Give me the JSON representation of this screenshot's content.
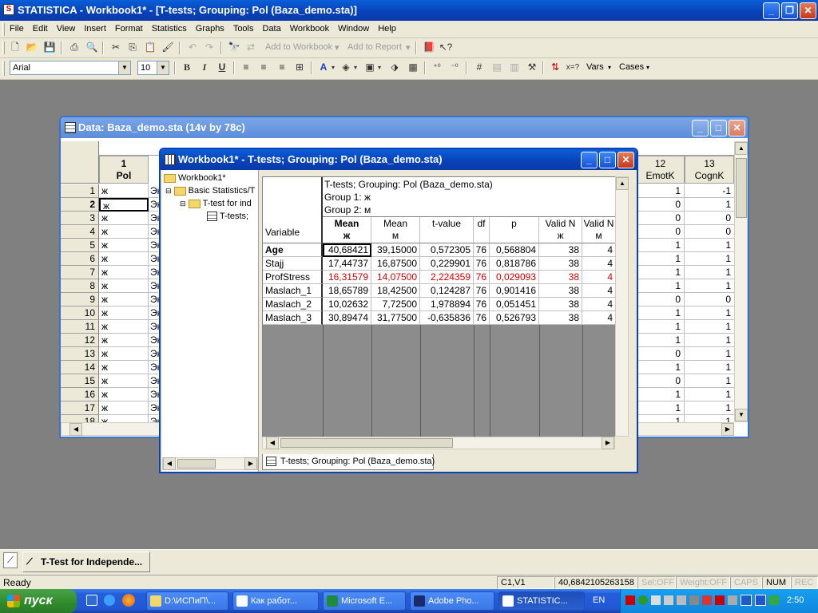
{
  "app": {
    "title": "STATISTICA - Workbook1* - [T-tests; Grouping: Pol (Baza_demo.sta)]",
    "icon_letter": "S"
  },
  "menu": [
    "File",
    "Edit",
    "View",
    "Insert",
    "Format",
    "Statistics",
    "Graphs",
    "Tools",
    "Data",
    "Workbook",
    "Window",
    "Help"
  ],
  "toolbar": {
    "add_to_workbook": "Add to Workbook",
    "add_to_report": "Add to Report",
    "font": "Arial",
    "font_size": "10",
    "bold": "B",
    "italic": "I",
    "underline": "U",
    "vars": "Vars",
    "cases": "Cases"
  },
  "datawin": {
    "title": "Data: Baza_demo.sta (14v by 78c)",
    "col1_num": "1",
    "col1_name": "Pol",
    "col12_num": "12",
    "col12_name": "EmotK",
    "col13_num": "13",
    "col13_name": "CognK",
    "rows": [
      {
        "n": "1",
        "pol": "ж",
        "e": "Эк",
        "c12": "1",
        "c13": "-1"
      },
      {
        "n": "2",
        "pol": "ж",
        "e": "Эк",
        "c12": "0",
        "c13": "1"
      },
      {
        "n": "3",
        "pol": "ж",
        "e": "Эк",
        "c12": "0",
        "c13": "0"
      },
      {
        "n": "4",
        "pol": "ж",
        "e": "Эк",
        "c12": "0",
        "c13": "0"
      },
      {
        "n": "5",
        "pol": "ж",
        "e": "Эк",
        "c12": "1",
        "c13": "1"
      },
      {
        "n": "6",
        "pol": "ж",
        "e": "Эк",
        "c12": "1",
        "c13": "1"
      },
      {
        "n": "7",
        "pol": "ж",
        "e": "Эк",
        "c12": "1",
        "c13": "1"
      },
      {
        "n": "8",
        "pol": "ж",
        "e": "Эк",
        "c12": "1",
        "c13": "1"
      },
      {
        "n": "9",
        "pol": "ж",
        "e": "Эк",
        "c12": "0",
        "c13": "0"
      },
      {
        "n": "10",
        "pol": "ж",
        "e": "Эк",
        "c12": "1",
        "c13": "1"
      },
      {
        "n": "11",
        "pol": "ж",
        "e": "Эк",
        "c12": "1",
        "c13": "1"
      },
      {
        "n": "12",
        "pol": "ж",
        "e": "Эк",
        "c12": "1",
        "c13": "1"
      },
      {
        "n": "13",
        "pol": "ж",
        "e": "Эк",
        "c12": "0",
        "c13": "1"
      },
      {
        "n": "14",
        "pol": "ж",
        "e": "Эк",
        "c12": "1",
        "c13": "1"
      },
      {
        "n": "15",
        "pol": "ж",
        "e": "Эк",
        "c12": "0",
        "c13": "1"
      },
      {
        "n": "16",
        "pol": "ж",
        "e": "Эк",
        "c12": "1",
        "c13": "1"
      },
      {
        "n": "17",
        "pol": "ж",
        "e": "Эк",
        "c12": "1",
        "c13": "1"
      },
      {
        "n": "18",
        "pol": "ж",
        "e": "Эк",
        "c12": "1",
        "c13": "1"
      }
    ]
  },
  "wbwin": {
    "title": "Workbook1* - T-tests; Grouping: Pol (Baza_demo.sta)",
    "tree": [
      "Workbook1*",
      "Basic Statistics/T",
      "T-test for ind",
      "T-tests;"
    ],
    "tab": "T-tests; Grouping: Pol (Baza_demo.sta)",
    "header_lines": [
      "T-tests; Grouping: Pol (Baza_demo.sta)",
      "Group 1: ж",
      "Group 2: м"
    ],
    "variable_label": "Variable",
    "cols": [
      {
        "a": "Mean",
        "b": "ж"
      },
      {
        "a": "Mean",
        "b": "м"
      },
      {
        "a": "t-value",
        "b": ""
      },
      {
        "a": "df",
        "b": ""
      },
      {
        "a": "p",
        "b": ""
      },
      {
        "a": "Valid N",
        "b": "ж"
      },
      {
        "a": "Valid N",
        "b": "м"
      }
    ],
    "rows": [
      {
        "v": "Age",
        "m1": "40,68421",
        "m2": "39,15000",
        "t": "0,572305",
        "df": "76",
        "p": "0,568804",
        "n1": "38",
        "n2": "4"
      },
      {
        "v": "Stajj",
        "m1": "17,44737",
        "m2": "16,87500",
        "t": "0,229901",
        "df": "76",
        "p": "0,818786",
        "n1": "38",
        "n2": "4"
      },
      {
        "v": "ProfStress",
        "m1": "16,31579",
        "m2": "14,07500",
        "t": "2,224359",
        "df": "76",
        "p": "0,029093",
        "n1": "38",
        "n2": "4"
      },
      {
        "v": "Maslach_1",
        "m1": "18,65789",
        "m2": "18,42500",
        "t": "0,124287",
        "df": "76",
        "p": "0,901416",
        "n1": "38",
        "n2": "4"
      },
      {
        "v": "Maslach_2",
        "m1": "10,02632",
        "m2": "7,72500",
        "t": "1,978894",
        "df": "76",
        "p": "0,051451",
        "n1": "38",
        "n2": "4"
      },
      {
        "v": "Maslach_3",
        "m1": "30,89474",
        "m2": "31,77500",
        "t": "-0,635836",
        "df": "76",
        "p": "0,526793",
        "n1": "38",
        "n2": "4"
      }
    ],
    "highlight_color": "#d40000"
  },
  "minimized": {
    "label": "T-Test for Independe..."
  },
  "status": {
    "ready": "Ready",
    "cell": "C1,V1",
    "value": "40,6842105263158",
    "sel": "Sel:OFF",
    "weight": "Weight:OFF",
    "caps": "CAPS",
    "num": "NUM",
    "rec": "REC"
  },
  "taskbar": {
    "start": "пуск",
    "tasks": [
      "D:\\ИСПиП\\...",
      "Как работ...",
      "Microsoft E...",
      "Adobe Pho...",
      "STATISTIC..."
    ],
    "lang": "EN",
    "clock": "2:50"
  }
}
